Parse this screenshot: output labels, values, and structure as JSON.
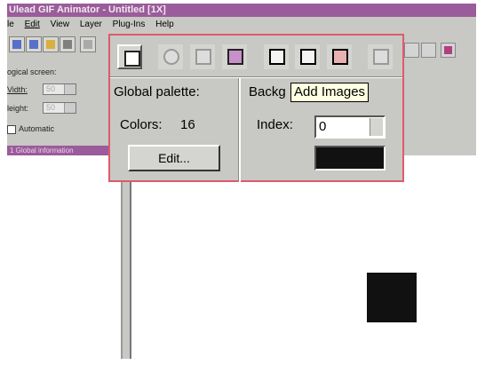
{
  "app": {
    "title": "Ulead GIF Animator - Untitled [1X]"
  },
  "menu": [
    "le",
    "Edit",
    "View",
    "Layer",
    "Plug-Ins",
    "Help"
  ],
  "left_panel": {
    "logical_screen_label": "ogical screen:",
    "width_label": "Vidth:",
    "width_value": "50",
    "height_label": "leight:",
    "height_value": "50",
    "automatic_label": "Automatic"
  },
  "tree": {
    "header": "1  Global information"
  },
  "inset": {
    "global_palette_label": "Global palette:",
    "colors_label": "Colors:",
    "colors_value": "16",
    "edit_button": "Edit...",
    "background_label": "Backg",
    "tooltip": "Add Images",
    "index_label": "Index:",
    "index_value": "0"
  },
  "colors": {
    "title_bar": "#9a5c9a",
    "highlight_border": "#e05a6a",
    "background_color_swatch": "#111111"
  },
  "icons": [
    "properties-icon",
    "cut-icon",
    "copy-icon",
    "paste-icon",
    "add-image-icon",
    "add-video-icon",
    "add-text-icon",
    "delete-frame-icon"
  ]
}
